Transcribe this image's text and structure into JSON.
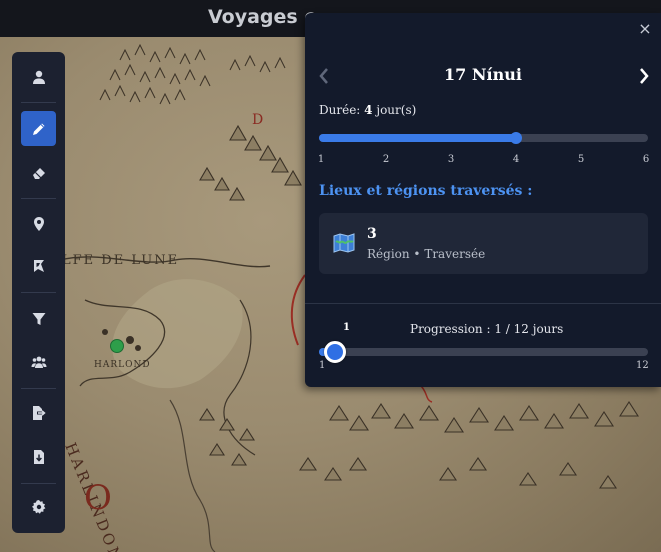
{
  "app": {
    "title": "Voyages e"
  },
  "map": {
    "labels": {
      "region_lindon": "LFE DE LUNE",
      "harlond": "HARLOND",
      "region_harlindon": "HARLINDON",
      "rune_1": "D",
      "rune_2": "O"
    }
  },
  "toolbar": {
    "items": [
      {
        "name": "user-icon",
        "active": false
      },
      {
        "name": "pencil-icon",
        "active": true
      },
      {
        "name": "eraser-icon",
        "active": false
      },
      {
        "name": "map-pin-icon",
        "active": false
      },
      {
        "name": "map-flag-icon",
        "active": false
      },
      {
        "name": "filter-icon",
        "active": false
      },
      {
        "name": "users-icon",
        "active": false
      },
      {
        "name": "export-icon",
        "active": false
      },
      {
        "name": "import-icon",
        "active": false
      },
      {
        "name": "settings-icon",
        "active": false
      }
    ]
  },
  "panel": {
    "close_label": "×",
    "day_title": "17 Nínui",
    "duration": {
      "label": "Durée:",
      "value": "4",
      "unit": "jour(s)",
      "min": 1,
      "max": 6,
      "current": 4,
      "ticks": [
        "1",
        "2",
        "3",
        "4",
        "5",
        "6"
      ]
    },
    "places_heading": "Lieux et régions traversés :",
    "places": [
      {
        "name": "3",
        "meta": "Région • Traversée",
        "icon": "map-icon"
      }
    ],
    "progress": {
      "value_label": "1",
      "label": "Progression : 1 / 12 jours",
      "min_label": "1",
      "max_label": "12",
      "current": 1,
      "total": 12
    }
  },
  "colors": {
    "accent": "#3a7be8",
    "heading": "#4d93f2",
    "panel_bg": "#131a2b",
    "toolbar_bg": "#1c2130",
    "map_marker": "#2e9e4a"
  }
}
